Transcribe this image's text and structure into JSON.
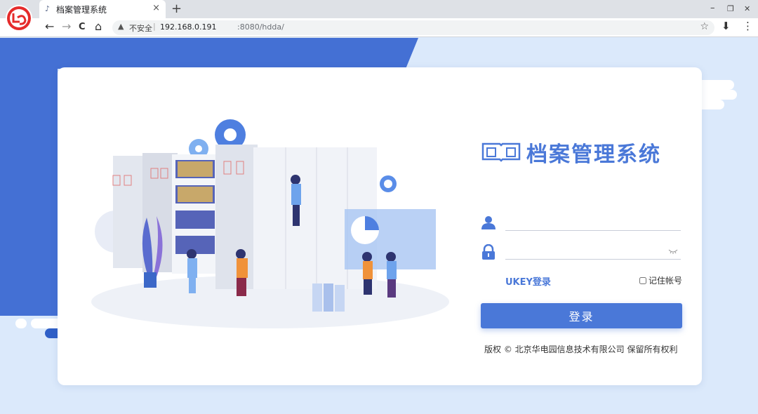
{
  "browser": {
    "tab_title": "档案管理系统",
    "tab_close": "×",
    "new_tab": "+",
    "security_label": "不安全",
    "url_host": "192.168.0.191",
    "url_rest": ":8080/hdda/",
    "nav_back": "←",
    "nav_forward": "→",
    "nav_reload": "C",
    "nav_home": "⌂",
    "minimize": "–",
    "restore": "❐",
    "close": "✕",
    "star": "☆",
    "download": "⬇",
    "menu": "⋮"
  },
  "login": {
    "system_title": "档案管理系统",
    "username_placeholder": "",
    "password_placeholder": "",
    "ukey_link": "UKEY登录",
    "remember_label": "记住帐号",
    "submit_label": "登录",
    "copyright": "版权 © 北京华电园信息技术有限公司 保留所有权利"
  },
  "colors": {
    "brand_blue": "#4a78d8",
    "bg_light": "#dbe9fb",
    "bg_dark": "#4470d4"
  }
}
